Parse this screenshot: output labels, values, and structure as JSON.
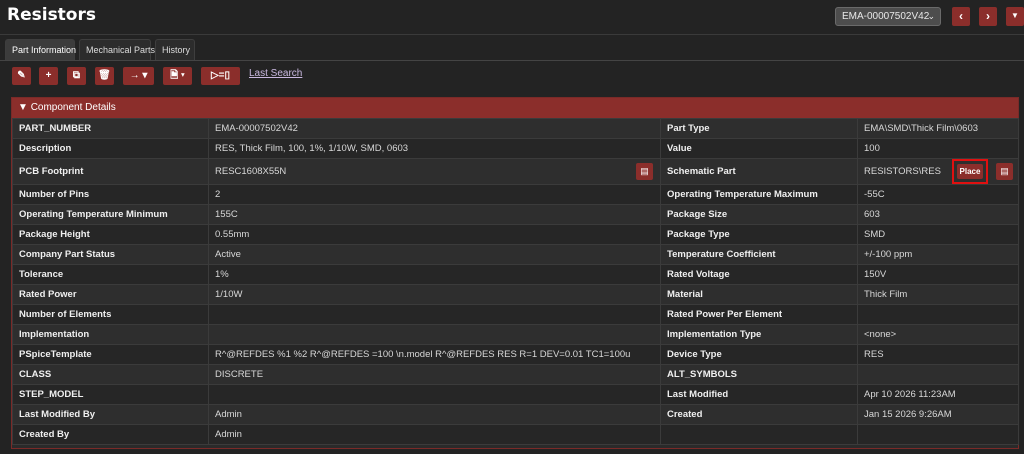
{
  "page": {
    "title": "Resistors"
  },
  "header": {
    "part_select_value": "EMA-00007502V42",
    "prev_icon": "chevron-left-icon",
    "next_icon": "chevron-right-icon",
    "menu_icon": "caret-down-icon"
  },
  "tabs": [
    {
      "label": "Part Information",
      "active": true
    },
    {
      "label": "Mechanical Parts",
      "active": false
    },
    {
      "label": "History",
      "active": false
    }
  ],
  "toolbar": {
    "icons": [
      "pencil-icon",
      "plus-icon",
      "copy-icon",
      "trash-icon",
      "arrow-right-dropdown-icon",
      "file-dropdown-icon",
      "link-equals-icon"
    ],
    "last_search_label": "Last Search"
  },
  "panel": {
    "title": "Component Details",
    "rows": [
      {
        "l1": "PART_NUMBER",
        "v1": "EMA-00007502V42",
        "l2": "Part Type",
        "v2": "EMA\\SMD\\Thick Film\\0603"
      },
      {
        "l1": "Description",
        "v1": "RES, Thick Film, 100, 1%, 1/10W, SMD, 0603",
        "l2": "Value",
        "v2": "100"
      },
      {
        "l1": "PCB Footprint",
        "v1": "RESC1608X55N",
        "l2": "Schematic Part",
        "v2": "RESISTORS\\RES"
      },
      {
        "l1": "Number of Pins",
        "v1": "2",
        "l2": "Operating Temperature Maximum",
        "v2": "-55C"
      },
      {
        "l1": "Operating Temperature Minimum",
        "v1": "155C",
        "l2": "Package Size",
        "v2": "603"
      },
      {
        "l1": "Package Height",
        "v1": "0.55mm",
        "l2": "Package Type",
        "v2": "SMD"
      },
      {
        "l1": "Company Part Status",
        "v1": "Active",
        "l2": "Temperature Coefficient",
        "v2": "+/-100 ppm"
      },
      {
        "l1": "Tolerance",
        "v1": "1%",
        "l2": "Rated Voltage",
        "v2": "150V"
      },
      {
        "l1": "Rated Power",
        "v1": "1/10W",
        "l2": "Material",
        "v2": "Thick Film"
      },
      {
        "l1": "Number of Elements",
        "v1": "",
        "l2": "Rated Power Per Element",
        "v2": ""
      },
      {
        "l1": "Implementation",
        "v1": "",
        "l2": "Implementation Type",
        "v2": "<none>"
      },
      {
        "l1": "PSpiceTemplate",
        "v1": "R^@REFDES %1 %2 R^@REFDES =100 \\n.model R^@REFDES RES R=1 DEV=0.01 TC1=100u",
        "l2": "Device Type",
        "v2": "RES"
      },
      {
        "l1": "CLASS",
        "v1": "DISCRETE",
        "l2": "ALT_SYMBOLS",
        "v2": ""
      },
      {
        "l1": "STEP_MODEL",
        "v1": "",
        "l2": "Last Modified",
        "v2": "Apr 10 2026 11:23AM"
      },
      {
        "l1": "Last Modified By",
        "v1": "Admin",
        "l2": "Created",
        "v2": "Jan 15 2026 9:26AM"
      },
      {
        "l1": "Created By",
        "v1": "Admin",
        "l2": "",
        "v2": ""
      }
    ],
    "place_button_label": "Place",
    "image_icon": "image-icon"
  },
  "colors": {
    "accent": "#8b2e2b",
    "background": "#232323",
    "highlight": "#e01010",
    "link": "#c9b8e0"
  }
}
